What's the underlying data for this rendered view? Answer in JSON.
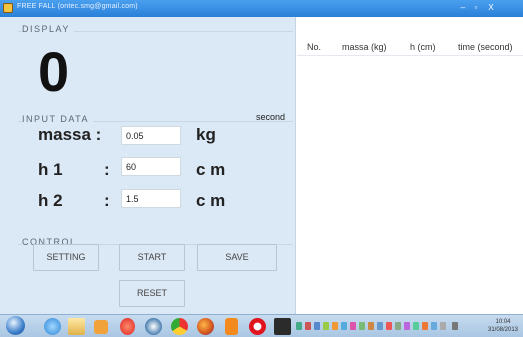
{
  "window": {
    "title": "FREE FALL (ontec.smg@gmail.com)",
    "controls": {
      "minimize": "–",
      "maximize": "▫",
      "close": "X"
    }
  },
  "display": {
    "group_label": "DISPLAY",
    "value": "0",
    "unit": "second"
  },
  "input": {
    "group_label": "INPUT DATA",
    "massa": {
      "label": "massa :",
      "value": "0.05",
      "unit": "kg"
    },
    "h1": {
      "label": "h 1",
      "colon": ":",
      "value": "60",
      "unit": "c m"
    },
    "h2": {
      "label": "h 2",
      "colon": ":",
      "value": "1.5",
      "unit": "c m"
    }
  },
  "control": {
    "group_label": "CONTROL",
    "setting": "SETTING",
    "start": "START",
    "save": "SAVE",
    "reset": "RESET"
  },
  "table": {
    "columns": [
      "No.",
      "massa (kg)",
      "h (cm)",
      "time (second)"
    ]
  },
  "taskbar": {
    "apps": [
      "start-orb-icon",
      "ie-icon",
      "explorer-icon",
      "media-icon",
      "paint-icon",
      "clock-app-icon",
      "chrome-icon",
      "firefox-icon",
      "vlc-icon",
      "opera-icon",
      "app-icon"
    ],
    "time": "10:04",
    "date": "31/08/2013"
  },
  "colors": {
    "panel": "#dbe8f5",
    "titlebar": "#3a8fe4",
    "taskbar": "#b8d1ea"
  }
}
